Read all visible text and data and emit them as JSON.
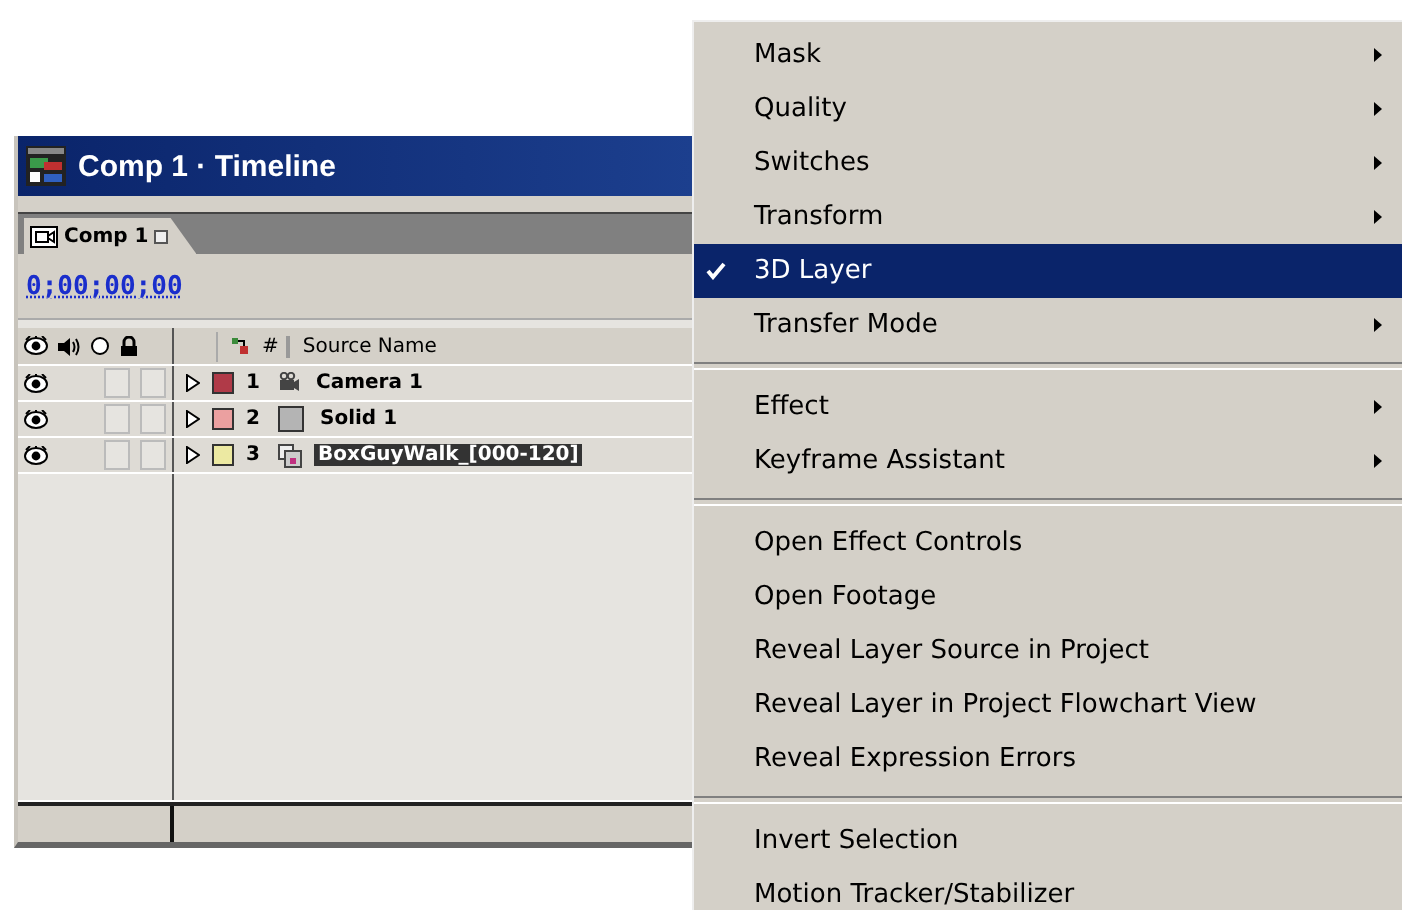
{
  "window": {
    "title": "Comp 1 · Timeline",
    "tab": {
      "label": "Comp 1",
      "selected": true
    },
    "timecode": "0;00;00;00",
    "columns": [
      "#",
      "Source Name"
    ],
    "layers": [
      {
        "number": "1",
        "name": "Camera 1",
        "kind": "camera",
        "color": "#b03a48",
        "video": true,
        "expanded": false,
        "selected": false
      },
      {
        "number": "2",
        "name": "Solid 1",
        "kind": "solid",
        "color": "#eba0a0",
        "video": true,
        "expanded": false,
        "selected": false
      },
      {
        "number": "3",
        "name": "BoxGuyWalk_[000-120]",
        "kind": "footage",
        "color": "#ece9a2",
        "video": true,
        "expanded": false,
        "selected": true
      }
    ]
  },
  "menu": {
    "groups": [
      [
        {
          "label": "Mask",
          "submenu": true,
          "checked": false,
          "selected": false
        },
        {
          "label": "Quality",
          "submenu": true,
          "checked": false,
          "selected": false
        },
        {
          "label": "Switches",
          "submenu": true,
          "checked": false,
          "selected": false
        },
        {
          "label": "Transform",
          "submenu": true,
          "checked": false,
          "selected": false
        },
        {
          "label": "3D Layer",
          "submenu": false,
          "checked": true,
          "selected": true
        },
        {
          "label": "Transfer Mode",
          "submenu": true,
          "checked": false,
          "selected": false
        }
      ],
      [
        {
          "label": "Effect",
          "submenu": true,
          "checked": false,
          "selected": false
        },
        {
          "label": "Keyframe Assistant",
          "submenu": true,
          "checked": false,
          "selected": false
        }
      ],
      [
        {
          "label": "Open Effect Controls",
          "submenu": false,
          "checked": false,
          "selected": false
        },
        {
          "label": "Open Footage",
          "submenu": false,
          "checked": false,
          "selected": false
        },
        {
          "label": "Reveal Layer Source in Project",
          "submenu": false,
          "checked": false,
          "selected": false
        },
        {
          "label": "Reveal Layer in Project Flowchart View",
          "submenu": false,
          "checked": false,
          "selected": false
        },
        {
          "label": "Reveal Expression Errors",
          "submenu": false,
          "checked": false,
          "selected": false
        }
      ],
      [
        {
          "label": "Invert Selection",
          "submenu": false,
          "checked": false,
          "selected": false
        },
        {
          "label": "Motion Tracker/Stabilizer",
          "submenu": false,
          "checked": false,
          "selected": false
        }
      ]
    ]
  }
}
